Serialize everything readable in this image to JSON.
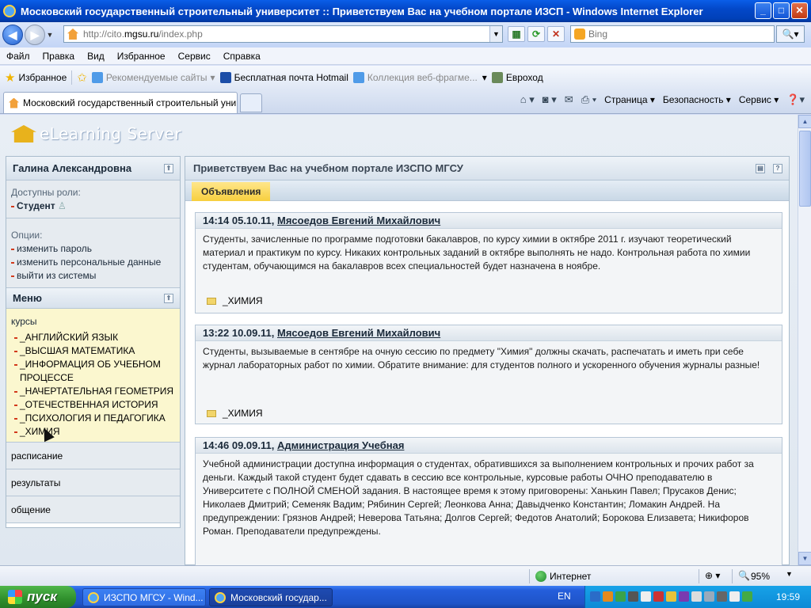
{
  "window": {
    "title": "Московский государственный строительный университет :: Приветствуем Вас на учебном портале ИЗСП - Windows Internet Explorer",
    "min": "_",
    "max": "□",
    "close": "✕"
  },
  "address": {
    "url_prefix": "http://cito.",
    "url_host": "mgsu.ru",
    "url_path": "/index.php",
    "search_placeholder": "Bing"
  },
  "menubar": [
    "Файл",
    "Правка",
    "Вид",
    "Избранное",
    "Сервис",
    "Справка"
  ],
  "favorites": {
    "label": "Избранное",
    "items": [
      "Рекомендуемые сайты",
      "Бесплатная почта Hotmail",
      "Коллекция веб-фрагме...",
      "Евроход"
    ]
  },
  "tab": {
    "title": "Московский государственный строительный унив..."
  },
  "commandbar": {
    "page": "Страница",
    "safety": "Безопасность",
    "tools": "Сервис"
  },
  "site": {
    "logo": "eLearning Server"
  },
  "left": {
    "user_name": "Галина  Александровна",
    "roles_label": "Доступны роли:",
    "role": "Студент",
    "options_label": "Опции:",
    "options": [
      "изменить пароль",
      "изменить персональные данные",
      "выйти из системы"
    ],
    "menu_title": "Меню",
    "courses_label": "курсы",
    "courses": [
      "_АНГЛИЙСКИЙ ЯЗЫК",
      "_ВЫСШАЯ МАТЕМАТИКА",
      "_ИНФОРМАЦИЯ ОБ УЧЕБНОМ ПРОЦЕССЕ",
      "_НАЧЕРТАТЕЛЬНАЯ ГЕОМЕТРИЯ",
      "_ОТЕЧЕСТВЕННАЯ ИСТОРИЯ",
      "_ПСИХОЛОГИЯ И ПЕДАГОГИКА",
      "_ХИМИЯ"
    ],
    "links": [
      "расписание",
      "результаты",
      "общение"
    ]
  },
  "right": {
    "header": "Приветствуем Вас на учебном портале ИЗСПО МГСУ",
    "tab": "Объявления",
    "news": [
      {
        "time": "14:14 05.10.11,",
        "author": "Мясоедов Евгений Михайлович",
        "text": "Студенты, зачисленные по программе подготовки бакалавров, по курсу химии в октябре 2011 г. изучают теоретический материал и практикум по курсу. Никаких контрольных заданий в октябре выполнять не надо. Контрольная работа по химии студентам, обучающимся на бакалавров всех специальностей будет назначена в ноябре.",
        "course": "_ХИМИЯ"
      },
      {
        "time": "13:22 10.09.11,",
        "author": "Мясоедов Евгений Михайлович",
        "text": "Студенты, вызываемые в сентябре на очную сессию по предмету \"Химия\" должны скачать, распечатать и иметь при себе журнал лабораторных работ по химии. Обратите внимание: для студентов полного и ускоренного обучения журналы разные!",
        "course": "_ХИМИЯ"
      },
      {
        "time": "14:46 09.09.11,",
        "author": "Администрация Учебная",
        "text": "Учебной администрации доступна информация о студентах, обратившихся за выполнением контрольных и прочих работ за деньги. Каждый такой студент будет сдавать в сессию все контрольные, курсовые работы ОЧНО преподавателю в Университете с ПОЛНОЙ СМЕНОЙ задания. В настоящее время к этому приговорены: Ханькин Павел; Прусаков Денис; Николаев Дмитрий; Семеняк Вадим; Рябинин Сергей; Леонкова Анна; Давыдченко Константин; Ломакин Андрей. На предупреждении: Грязнов Андрей; Неверова Татьяна; Долгов Сергей; Федотов Анатолий; Борокова Елизавета; Никифоров Роман. Преподаватели предупреждены."
      }
    ]
  },
  "status": {
    "zone": "Интернет",
    "zoom": "95%"
  },
  "taskbar": {
    "start": "пуск",
    "tasks": [
      "ИЗСПО МГСУ - Wind...",
      "Московский государ..."
    ],
    "lang": "EN",
    "clock": "19:59"
  },
  "colors": {
    "accent": "#0348c9",
    "announce_tab": "#f7cf3e",
    "menu_bg": "#fbf7cf",
    "bullet": "#d23a1c"
  }
}
